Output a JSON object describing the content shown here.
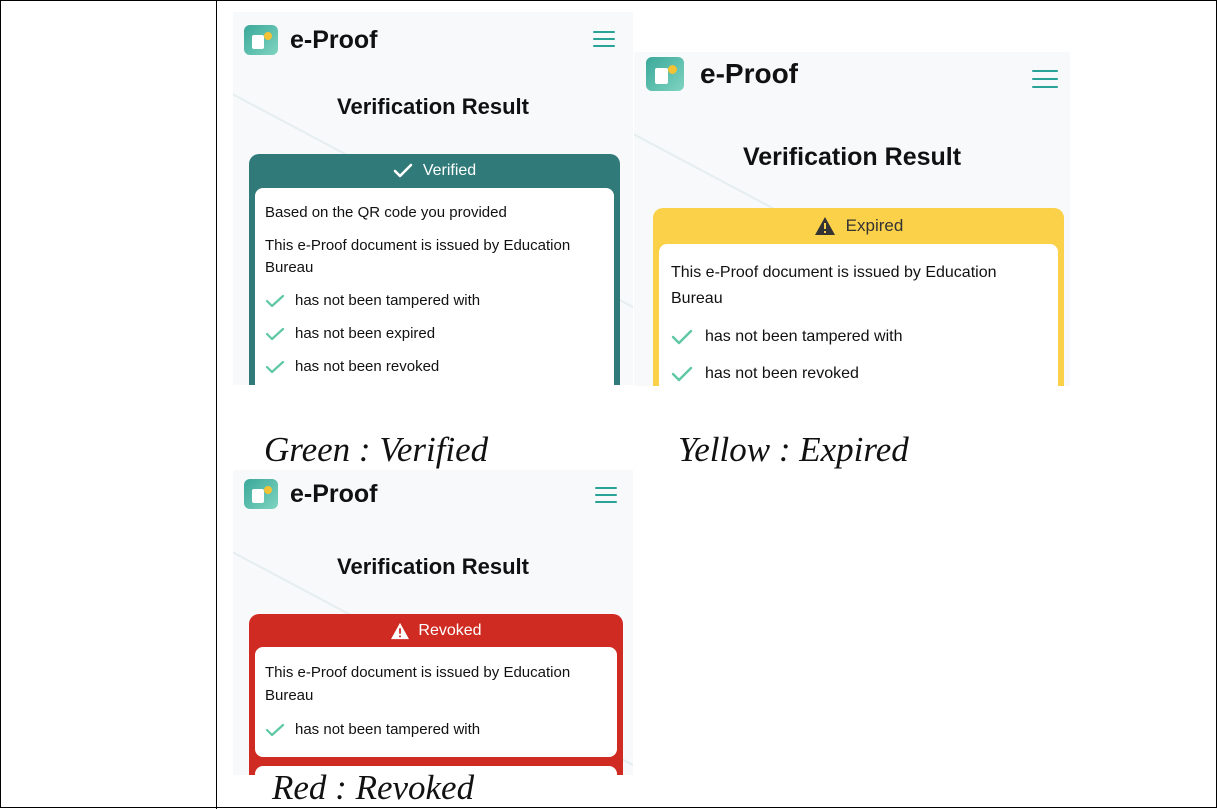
{
  "colors": {
    "verified": "#317a7a",
    "expired": "#fcd14a",
    "revoked": "#cf2b22",
    "check": "#5ec8a3",
    "menu": "#2aa397"
  },
  "icons": {
    "logo": "e-proof-logo-icon",
    "menu": "hamburger-menu-icon",
    "check": "check-icon",
    "warning": "warning-triangle-icon"
  },
  "screens": [
    {
      "brand": "e-Proof",
      "heading": "Verification Result",
      "status": "Verified",
      "lines": [
        "Based on the QR code you provided",
        "This e-Proof document is issued by Education",
        "Bureau"
      ],
      "checks": [
        "has not been tampered with",
        "has not been expired",
        "has not been revoked"
      ],
      "caption": "Green : Verified"
    },
    {
      "brand": "e-Proof",
      "heading": "Verification Result",
      "status": "Expired",
      "lines": [
        "This e-Proof document is issued by Education",
        "Bureau"
      ],
      "checks": [
        "has not been tampered with",
        "has not been revoked"
      ],
      "caption": "Yellow : Expired"
    },
    {
      "brand": "e-Proof",
      "heading": "Verification Result",
      "status": "Revoked",
      "lines": [
        "This e-Proof document is issued by Education",
        "Bureau"
      ],
      "checks": [
        "has not been tampered with"
      ],
      "caption": "Red : Revoked"
    }
  ]
}
